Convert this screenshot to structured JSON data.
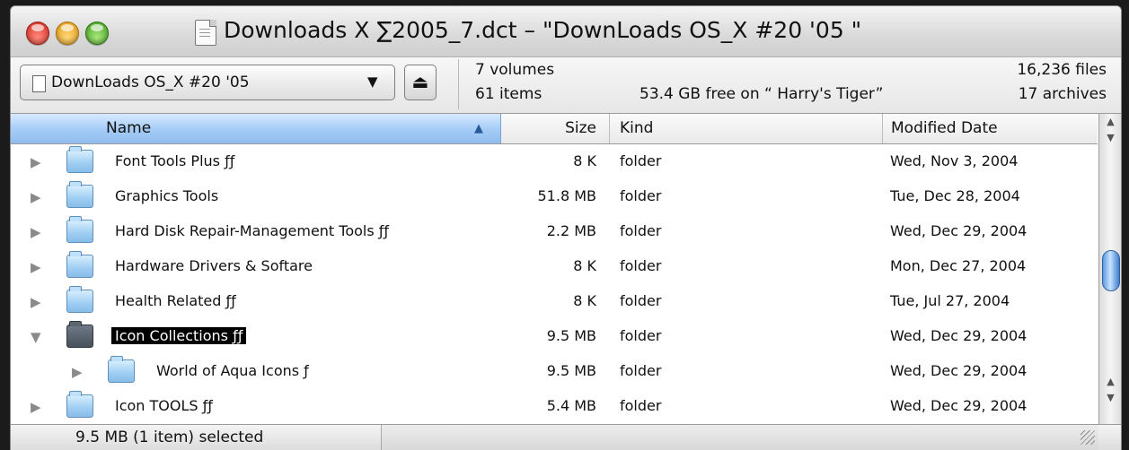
{
  "window": {
    "title": "Downloads X ∑2005_7.dct  – \"DownLoads OS_X  #20  '05 \""
  },
  "toolbar": {
    "location_popup": "DownLoads OS_X  #20  '05",
    "popup_arrow": "▼",
    "eject_glyph": "⏏"
  },
  "info": {
    "volumes": "7 volumes",
    "items": "61 items",
    "free_space": "53.4 GB free on “ Harry's Tiger”",
    "files": "16,236 files",
    "archives": "17 archives"
  },
  "columns": {
    "name": "Name",
    "size": "Size",
    "kind": "Kind",
    "modified": "Modified Date",
    "sort_indicator": "▲"
  },
  "rows": [
    {
      "name": "Font Tools Plus  ƒƒ",
      "size": "8 K",
      "kind": "folder",
      "date": "Wed, Nov 3, 2004",
      "expanded": false,
      "selected": false,
      "indent": 0
    },
    {
      "name": "Graphics Tools",
      "size": "51.8 MB",
      "kind": "folder",
      "date": "Tue, Dec 28, 2004",
      "expanded": false,
      "selected": false,
      "indent": 0
    },
    {
      "name": "Hard Disk Repair-Management Tools  ƒƒ",
      "size": "2.2 MB",
      "kind": "folder",
      "date": "Wed, Dec 29, 2004",
      "expanded": false,
      "selected": false,
      "indent": 0
    },
    {
      "name": "Hardware Drivers & Softare",
      "size": "8 K",
      "kind": "folder",
      "date": "Mon, Dec 27, 2004",
      "expanded": false,
      "selected": false,
      "indent": 0
    },
    {
      "name": "Health Related   ƒƒ",
      "size": "8 K",
      "kind": "folder",
      "date": "Tue, Jul 27, 2004",
      "expanded": false,
      "selected": false,
      "indent": 0
    },
    {
      "name": "Icon Collections  ƒƒ",
      "size": "9.5 MB",
      "kind": "folder",
      "date": "Wed, Dec 29, 2004",
      "expanded": true,
      "selected": true,
      "indent": 0
    },
    {
      "name": "World of Aqua Icons ƒ",
      "size": "9.5 MB",
      "kind": "folder",
      "date": "Wed, Dec 29, 2004",
      "expanded": false,
      "selected": false,
      "indent": 1
    },
    {
      "name": "Icon TOOLS  ƒƒ",
      "size": "5.4 MB",
      "kind": "folder",
      "date": "Wed, Dec 29, 2004",
      "expanded": false,
      "selected": false,
      "indent": 0
    }
  ],
  "status": {
    "selection": "9.5 MB (1 item) selected"
  },
  "colors": {
    "header_selected": "#a7cdf6",
    "selection_bg": "#000000",
    "folder_blue": "#9fcdf2",
    "scroll_thumb": "#5d9ae0"
  }
}
